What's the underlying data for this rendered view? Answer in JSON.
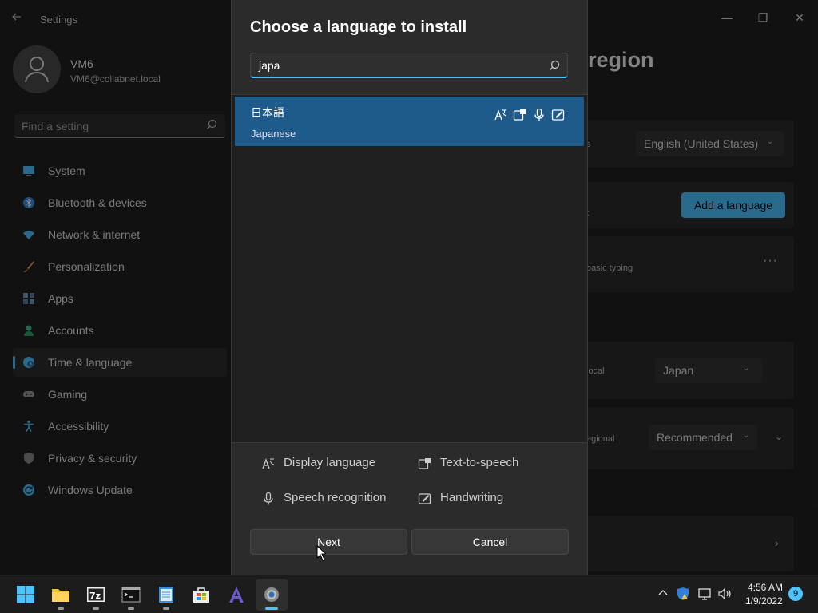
{
  "window": {
    "app_title": "Settings",
    "controls": {
      "minimize": "—",
      "maximize": "❐",
      "close": "✕"
    }
  },
  "profile": {
    "name": "VM6",
    "email": "VM6@collabnet.local"
  },
  "search": {
    "placeholder": "Find a setting"
  },
  "sidebar": {
    "items": [
      {
        "label": "System",
        "icon": "monitor-icon",
        "color": "#4cc2ff"
      },
      {
        "label": "Bluetooth & devices",
        "icon": "bluetooth-icon",
        "color": "#3a8de0"
      },
      {
        "label": "Network & internet",
        "icon": "wifi-icon",
        "color": "#4cc2ff"
      },
      {
        "label": "Personalization",
        "icon": "brush-icon",
        "color": "#e8a25a"
      },
      {
        "label": "Apps",
        "icon": "apps-icon",
        "color": "#7a9cc6"
      },
      {
        "label": "Accounts",
        "icon": "person-icon",
        "color": "#3fbf7f"
      },
      {
        "label": "Time & language",
        "icon": "globe-clock-icon",
        "color": "#4cc2ff",
        "active": true
      },
      {
        "label": "Gaming",
        "icon": "gamepad-icon",
        "color": "#999999"
      },
      {
        "label": "Accessibility",
        "icon": "accessibility-icon",
        "color": "#4cc2ff"
      },
      {
        "label": "Privacy & security",
        "icon": "shield-icon",
        "color": "#888888"
      },
      {
        "label": "Windows Update",
        "icon": "update-icon",
        "color": "#4cc2ff"
      }
    ]
  },
  "main": {
    "title_fragment": "region",
    "windows_display_language": "English (United States)",
    "frag_s": "s",
    "frag_t": "t",
    "add_language_label": "Add a language",
    "frag_typing": "basic typing",
    "more_label": "···",
    "frag_local": "local",
    "country_value": "Japan",
    "frag_regional": "egional",
    "regional_format_value": "Recommended"
  },
  "dialog": {
    "title": "Choose a language to install",
    "search_value": "japa",
    "results": [
      {
        "native": "日本語",
        "english": "Japanese"
      }
    ],
    "legend": {
      "display_language": "Display language",
      "text_to_speech": "Text-to-speech",
      "speech_recognition": "Speech recognition",
      "handwriting": "Handwriting"
    },
    "next_label": "Next",
    "cancel_label": "Cancel",
    "accent": "#4cc2ff",
    "selection_color": "#1e5a8a"
  },
  "taskbar": {
    "apps": [
      "start-icon",
      "file-explorer-icon",
      "7zip-icon",
      "terminal-icon",
      "notepad-icon",
      "store-icon",
      "font-app-icon",
      "settings-icon"
    ],
    "time": "4:56 AM",
    "date": "1/9/2022",
    "notification_count": "9"
  }
}
